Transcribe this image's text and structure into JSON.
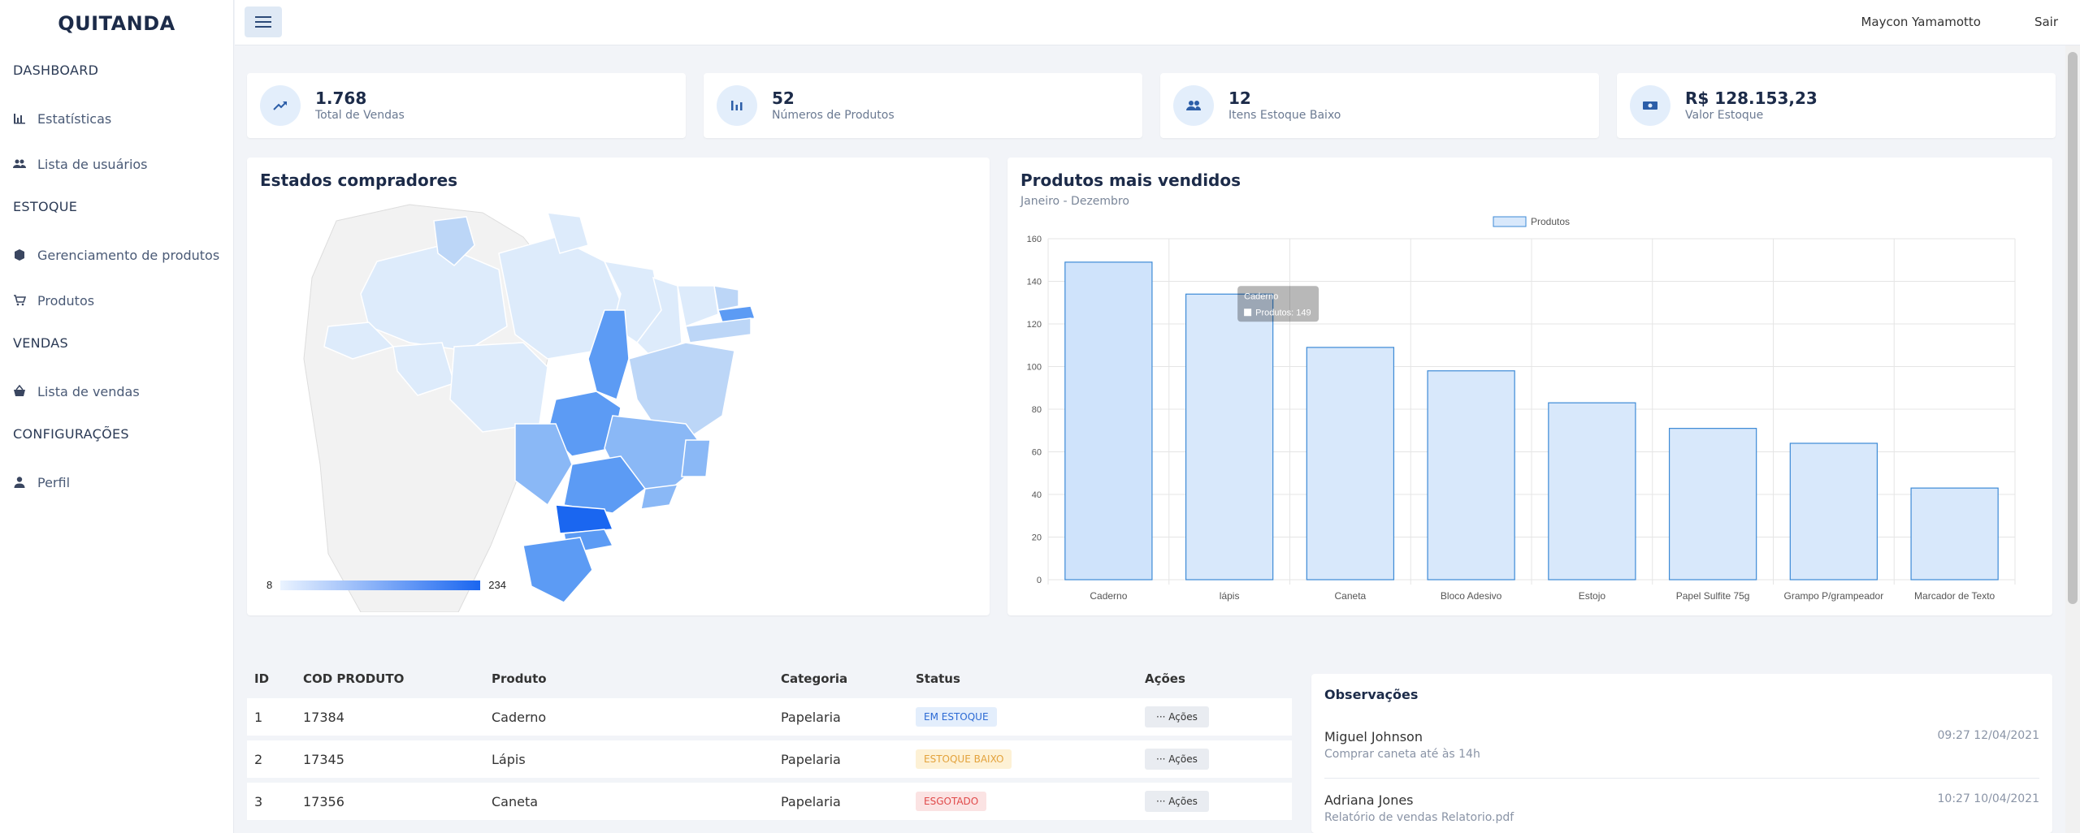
{
  "app": {
    "brand": "QUITANDA"
  },
  "sidebar": {
    "sections": [
      {
        "title": "DASHBOARD",
        "items": [
          {
            "label": "Estatísticas"
          },
          {
            "label": "Lista de usuários"
          }
        ]
      },
      {
        "title": "ESTOQUE",
        "items": [
          {
            "label": "Gerenciamento de produtos"
          },
          {
            "label": "Produtos"
          }
        ]
      },
      {
        "title": "VENDAS",
        "items": [
          {
            "label": "Lista de vendas"
          }
        ]
      },
      {
        "title": "CONFIGURAÇÕES",
        "items": [
          {
            "label": "Perfil"
          }
        ]
      }
    ]
  },
  "topbar": {
    "user": "Maycon Yamamotto",
    "logout": "Sair"
  },
  "stats": [
    {
      "value": "1.768",
      "label": "Total de Vendas",
      "icon": "trending-up-icon"
    },
    {
      "value": "52",
      "label": "Números de Produtos",
      "icon": "bar-chart-icon"
    },
    {
      "value": "12",
      "label": "Itens Estoque Baixo",
      "icon": "people-icon"
    },
    {
      "value": "R$ 128.153,23",
      "label": "Valor Estoque",
      "icon": "money-icon"
    }
  ],
  "map": {
    "title": "Estados compradores",
    "legend_min": "8",
    "legend_max": "234"
  },
  "chart_data": {
    "type": "bar",
    "title": "Produtos mais vendidos",
    "subtitle": "Janeiro - Dezembro",
    "categories": [
      "Caderno",
      "lápis",
      "Caneta",
      "Bloco Adesivo",
      "Estojo",
      "Papel Sulfite 75g",
      "Grampo P/grampeador",
      "Marcador de Texto"
    ],
    "series": [
      {
        "name": "Produtos",
        "values": [
          149,
          134,
          109,
          98,
          83,
          71,
          64,
          43
        ]
      }
    ],
    "ylim": [
      0,
      160
    ],
    "yticks": [
      0,
      20,
      40,
      60,
      80,
      100,
      120,
      140,
      160
    ],
    "grid": true,
    "legend": "top",
    "colors": {
      "bar_fill": "#d8e8fb",
      "bar_stroke": "#3d8ad6",
      "highlight_fill": "#cfe3fb"
    },
    "tooltip": {
      "title": "Caderno",
      "text": "Produtos: 149"
    }
  },
  "table": {
    "headers": [
      "ID",
      "COD PRODUTO",
      "Produto",
      "Categoria",
      "Status",
      "Ações"
    ],
    "rows": [
      {
        "id": "1",
        "cod": "17384",
        "produto": "Caderno",
        "categoria": "Papelaria",
        "status": "EM ESTOQUE",
        "action": "··· Ações"
      },
      {
        "id": "2",
        "cod": "17345",
        "produto": "Lápis",
        "categoria": "Papelaria",
        "status": "ESTOQUE BAIXO",
        "action": "··· Ações"
      },
      {
        "id": "3",
        "cod": "17356",
        "produto": "Caneta",
        "categoria": "Papelaria",
        "status": "ESGOTADO",
        "action": "··· Ações"
      }
    ]
  },
  "observations": {
    "title": "Observações",
    "items": [
      {
        "name": "Miguel Johnson",
        "time": "09:27 12/04/2021",
        "message": "Comprar caneta até às 14h"
      },
      {
        "name": "Adriana Jones",
        "time": "10:27 10/04/2021",
        "message": "Relatório de vendas Relatorio.pdf"
      }
    ]
  }
}
